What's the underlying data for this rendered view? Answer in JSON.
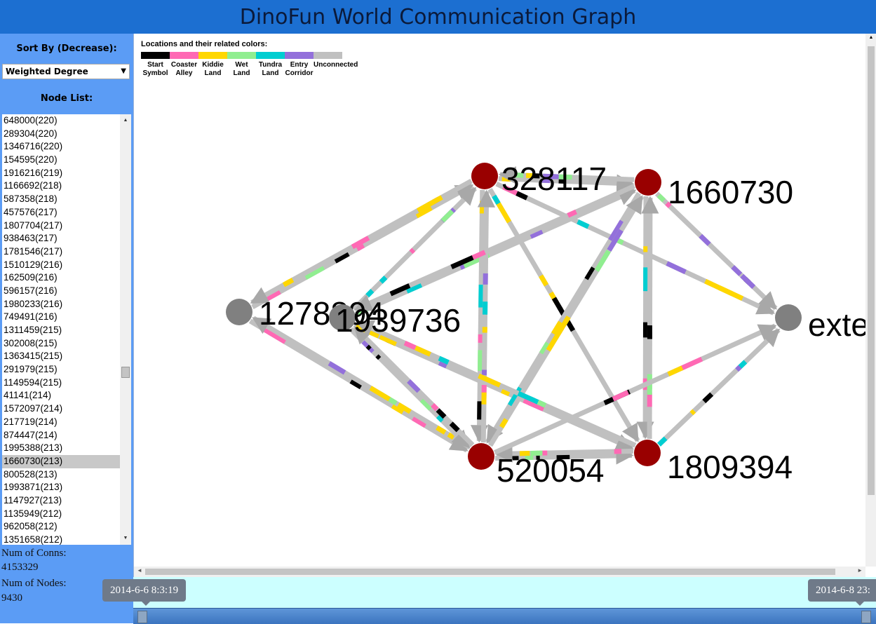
{
  "title": "DinoFun World Communication Graph",
  "sidebar": {
    "sort_label": "Sort By (Decrease):",
    "sort_value": "Weighted Degree",
    "node_list_label": "Node List:",
    "nodes": [
      "648000(220)",
      "289304(220)",
      "1346716(220)",
      "154595(220)",
      "1916216(219)",
      "1166692(218)",
      "587358(218)",
      "457576(217)",
      "1807704(217)",
      "938463(217)",
      "1781546(217)",
      "1510129(216)",
      "162509(216)",
      "596157(216)",
      "1980233(216)",
      "749491(216)",
      "1311459(215)",
      "302008(215)",
      "1363415(215)",
      "291979(215)",
      "1149594(215)",
      "41141(214)",
      "1572097(214)",
      "217719(214)",
      "874447(214)",
      "1995388(213)",
      "1660730(213)",
      "800528(213)",
      "1993871(213)",
      "1147927(213)",
      "1135949(212)",
      "962058(212)",
      "1351658(212)"
    ],
    "selected_node": "1660730(213)",
    "num_conns_label": "Num of Conns:",
    "num_conns_value": "4153329",
    "num_nodes_label": "Num of Nodes:",
    "num_nodes_value": "9430"
  },
  "legend": {
    "title": "Locations and their related colors:",
    "items": [
      {
        "label1": "Start",
        "label2": "Symbol",
        "color": "#000000"
      },
      {
        "label1": "Coaster",
        "label2": "Alley",
        "color": "#ff69b4"
      },
      {
        "label1": "Kiddie",
        "label2": "Land",
        "color": "#ffd700"
      },
      {
        "label1": "Wet",
        "label2": "Land",
        "color": "#90ee90"
      },
      {
        "label1": "Tundra",
        "label2": "Land",
        "color": "#00ced1"
      },
      {
        "label1": "Entry",
        "label2": "Corridor",
        "color": "#9370db"
      },
      {
        "label1": "Unconnected",
        "label2": "",
        "color": "#c0c0c0"
      }
    ]
  },
  "graph": {
    "nodes": [
      {
        "id": "328117",
        "label": "328117",
        "color": "#990000"
      },
      {
        "id": "1660730",
        "label": "1660730",
        "color": "#990000"
      },
      {
        "id": "1278894",
        "label": "1278894",
        "color": "#808080"
      },
      {
        "id": "1939736",
        "label": "1939736",
        "color": "#808080"
      },
      {
        "id": "external",
        "label": "exte",
        "color": "#808080"
      },
      {
        "id": "520054",
        "label": "520054",
        "color": "#990000"
      },
      {
        "id": "1809394",
        "label": "1809394",
        "color": "#990000"
      }
    ]
  },
  "timeline": {
    "start": "2014-6-6 8:3:19",
    "end": "2014-6-8 23:"
  }
}
